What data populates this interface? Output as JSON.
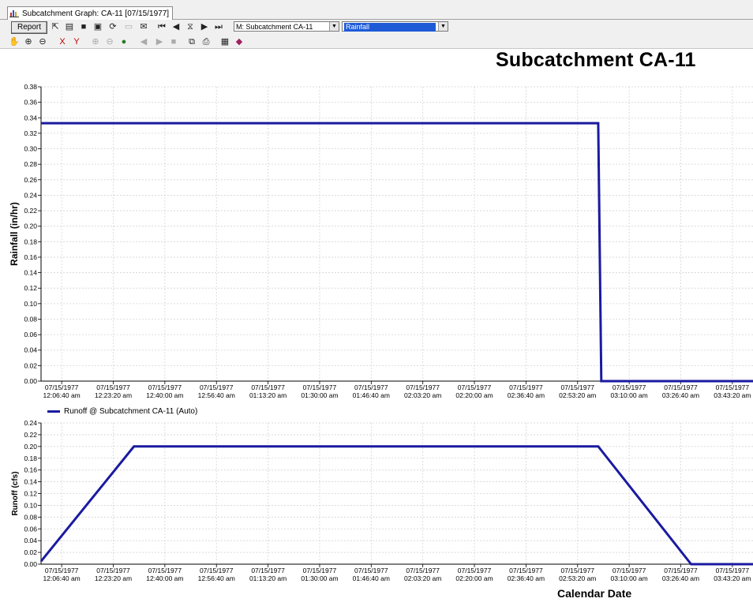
{
  "tab": {
    "title": "Subcatchment Graph: CA-11 [07/15/1977]"
  },
  "toolbar": {
    "report_label": "Report",
    "object_combo": "M: Subcatchment CA-11",
    "variable_combo": "Rainfall"
  },
  "colors": {
    "series": "#1a1aa0",
    "grid": "#d4d4d4",
    "selection": "#1e5ad6"
  },
  "chart_title": "Subcatchment CA-11",
  "x_axis_label": "Calendar Date",
  "legend": {
    "label": "Runoff @ Subcatchment CA-11 (Auto)"
  },
  "chart_data": [
    {
      "type": "line",
      "title": "Subcatchment CA-11",
      "ylabel": "Rainfall (in/hr)",
      "ylim": [
        0,
        0.38
      ],
      "yticks": [
        "0.00",
        "0.02",
        "0.04",
        "0.06",
        "0.08",
        "0.10",
        "0.12",
        "0.14",
        "0.16",
        "0.18",
        "0.20",
        "0.22",
        "0.24",
        "0.26",
        "0.28",
        "0.30",
        "0.32",
        "0.34",
        "0.36",
        "0.38"
      ],
      "xticks": [
        [
          "07/15/1977",
          "12:06:40 am"
        ],
        [
          "07/15/1977",
          "12:23:20 am"
        ],
        [
          "07/15/1977",
          "12:40:00 am"
        ],
        [
          "07/15/1977",
          "12:56:40 am"
        ],
        [
          "07/15/1977",
          "01:13:20 am"
        ],
        [
          "07/15/1977",
          "01:30:00 am"
        ],
        [
          "07/15/1977",
          "01:46:40 am"
        ],
        [
          "07/15/1977",
          "02:03:20 am"
        ],
        [
          "07/15/1977",
          "02:20:00 am"
        ],
        [
          "07/15/1977",
          "02:36:40 am"
        ],
        [
          "07/15/1977",
          "02:53:20 am"
        ],
        [
          "07/15/1977",
          "03:10:00 am"
        ],
        [
          "07/15/1977",
          "03:26:40 am"
        ],
        [
          "07/15/1977",
          "03:43:20 am"
        ]
      ],
      "grid": true,
      "series": [
        {
          "points": [
            [
              "12:00:00 am",
              0.333
            ],
            [
              "03:00:00 am",
              0.333
            ],
            [
              "03:01:00 am",
              0.0
            ],
            [
              "03:50:00 am",
              0.0
            ]
          ]
        }
      ]
    },
    {
      "type": "line",
      "ylabel": "Runoff (cfs)",
      "xlabel": "Calendar Date",
      "ylim": [
        0,
        0.24
      ],
      "yticks": [
        "0.00",
        "0.02",
        "0.04",
        "0.06",
        "0.08",
        "0.10",
        "0.12",
        "0.14",
        "0.16",
        "0.18",
        "0.20",
        "0.22",
        "0.24"
      ],
      "xticks": [
        [
          "07/15/1977",
          "12:06:40 am"
        ],
        [
          "07/15/1977",
          "12:23:20 am"
        ],
        [
          "07/15/1977",
          "12:40:00 am"
        ],
        [
          "07/15/1977",
          "12:56:40 am"
        ],
        [
          "07/15/1977",
          "01:13:20 am"
        ],
        [
          "07/15/1977",
          "01:30:00 am"
        ],
        [
          "07/15/1977",
          "01:46:40 am"
        ],
        [
          "07/15/1977",
          "02:03:20 am"
        ],
        [
          "07/15/1977",
          "02:20:00 am"
        ],
        [
          "07/15/1977",
          "02:36:40 am"
        ],
        [
          "07/15/1977",
          "02:53:20 am"
        ],
        [
          "07/15/1977",
          "03:10:00 am"
        ],
        [
          "07/15/1977",
          "03:26:40 am"
        ],
        [
          "07/15/1977",
          "03:43:20 am"
        ]
      ],
      "grid": true,
      "legend_position": "top-left",
      "series": [
        {
          "name": "Runoff @ Subcatchment CA-11 (Auto)",
          "points": [
            [
              "12:00:00 am",
              0.005
            ],
            [
              "12:30:00 am",
              0.2
            ],
            [
              "03:00:00 am",
              0.2
            ],
            [
              "03:30:00 am",
              0.0
            ],
            [
              "03:50:00 am",
              0.0
            ]
          ]
        }
      ]
    }
  ]
}
